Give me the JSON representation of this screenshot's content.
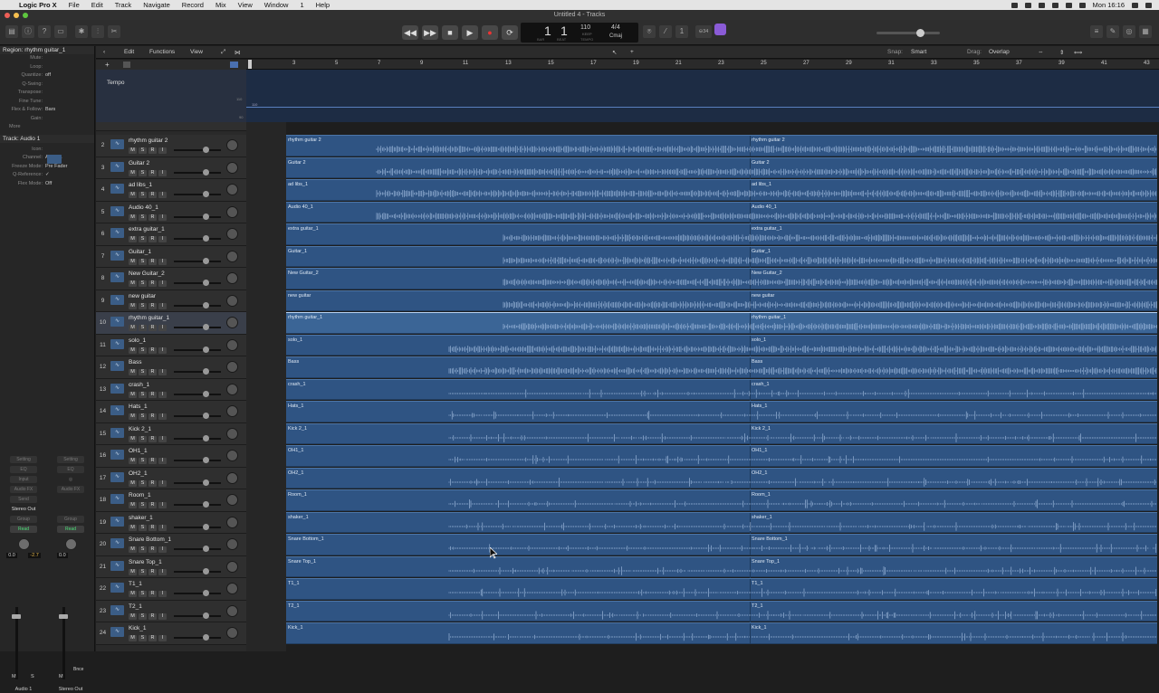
{
  "menubar": {
    "app": "Logic Pro X",
    "items": [
      "File",
      "Edit",
      "Track",
      "Navigate",
      "Record",
      "Mix",
      "View",
      "Window",
      "1",
      "Help"
    ],
    "clock": "Mon 16:16"
  },
  "window": {
    "title": "Untitled 4 - Tracks"
  },
  "transport": {
    "bar": "1",
    "beat": "1",
    "bar_label": "BAR",
    "beat_label": "BEAT",
    "tempo": "110",
    "keep_label": "KEEP",
    "tempo_label": "TEMPO",
    "signature": "4/4",
    "key": "Cmaj"
  },
  "toolbar": {
    "cpu_badge": "⊖34"
  },
  "inspector": {
    "region_header": "Region: rhythm guitar_1",
    "region_params": [
      {
        "k": "Mute:",
        "v": ""
      },
      {
        "k": "Loop:",
        "v": ""
      },
      {
        "k": "Quantize:",
        "v": "off"
      },
      {
        "k": "Q-Swing:",
        "v": ""
      },
      {
        "k": "Transpose:",
        "v": ""
      },
      {
        "k": "Fine Tune:",
        "v": ""
      },
      {
        "k": "Flex & Follow:",
        "v": "Bars"
      },
      {
        "k": "Gain:",
        "v": ""
      }
    ],
    "more": "More",
    "track_header": "Track: Audio 1",
    "track_params": [
      {
        "k": "Icon:",
        "v": ""
      },
      {
        "k": "Channel:",
        "v": "Audio 1"
      },
      {
        "k": "Freeze Mode:",
        "v": "Pre Fader"
      },
      {
        "k": "Q-Reference:",
        "v": "✓"
      },
      {
        "k": "Flex Mode:",
        "v": "Off"
      }
    ]
  },
  "strips": [
    {
      "setting": "Setting",
      "eq": "EQ",
      "input": "Input",
      "fx": "Audio FX",
      "send": "Send",
      "out": "Stereo Out",
      "group": "Group",
      "auto": "Read",
      "vol": "0.0",
      "pan": "-2.7",
      "name": "Audio 1",
      "m": "M",
      "s": "S"
    },
    {
      "setting": "Setting",
      "eq": "EQ",
      "input": "",
      "fx": "Audio FX",
      "send": "",
      "out": "",
      "group": "Group",
      "auto": "Read",
      "vol": "0.0",
      "pan": "",
      "name": "Stereo Out",
      "m": "M",
      "s": "Bnce"
    }
  ],
  "tracks_header": {
    "edit": "Edit",
    "functions": "Functions",
    "view": "View",
    "snap_label": "Snap:",
    "snap": "Smart",
    "drag_label": "Drag:",
    "drag": "Overlap"
  },
  "ruler": [
    "3",
    "5",
    "7",
    "9",
    "11",
    "13",
    "15",
    "17",
    "19",
    "21",
    "23",
    "25",
    "27",
    "29",
    "31",
    "33",
    "35",
    "37",
    "39",
    "41",
    "43"
  ],
  "tempo_track": {
    "label": "Tempo",
    "max": "110",
    "value": "110",
    "mid": "90"
  },
  "tracks": [
    {
      "num": "2",
      "name": "rhythm guitar 2",
      "region": "rhythm guitar 2"
    },
    {
      "num": "3",
      "name": "Guitar 2",
      "region": "Guitar 2"
    },
    {
      "num": "4",
      "name": "ad libs_1",
      "region": "ad libs_1"
    },
    {
      "num": "5",
      "name": "Audio 40_1",
      "region": "Audio 40_1"
    },
    {
      "num": "6",
      "name": "extra guitar_1",
      "region": "extra guitar_1"
    },
    {
      "num": "7",
      "name": "Guitar_1",
      "region": "Guitar_1"
    },
    {
      "num": "8",
      "name": "New Guitar_2",
      "region": "New Guitar_2"
    },
    {
      "num": "9",
      "name": "new guitar",
      "region": "new guitar"
    },
    {
      "num": "10",
      "name": "rhythm guitar_1",
      "region": "rhythm guitar_1"
    },
    {
      "num": "11",
      "name": "solo_1",
      "region": "solo_1"
    },
    {
      "num": "12",
      "name": "Bass",
      "region": "Bass"
    },
    {
      "num": "13",
      "name": "crash_1",
      "region": "crash_1"
    },
    {
      "num": "14",
      "name": "Hats_1",
      "region": "Hats_1"
    },
    {
      "num": "15",
      "name": "Kick 2_1",
      "region": "Kick 2_1"
    },
    {
      "num": "16",
      "name": "OH1_1",
      "region": "OH1_1"
    },
    {
      "num": "17",
      "name": "OH2_1",
      "region": "OH2_1"
    },
    {
      "num": "18",
      "name": "Room_1",
      "region": "Room_1"
    },
    {
      "num": "19",
      "name": "shaker_1",
      "region": "shaker_1"
    },
    {
      "num": "20",
      "name": "Snare Bottom_1",
      "region": "Snare Bottom_1"
    },
    {
      "num": "21",
      "name": "Snare Top_1",
      "region": "Snare Top_1"
    },
    {
      "num": "22",
      "name": "T1_1",
      "region": "T1_1"
    },
    {
      "num": "23",
      "name": "T2_1",
      "region": "T2_1"
    },
    {
      "num": "24",
      "name": "Kick_1",
      "region": "Kick_1"
    }
  ],
  "track_buttons": {
    "m": "M",
    "s": "S",
    "r": "R",
    "i": "I"
  },
  "colors": {
    "region": "#2f5483",
    "region_selected": "#3b6596",
    "accent": "#8a5bd6"
  }
}
